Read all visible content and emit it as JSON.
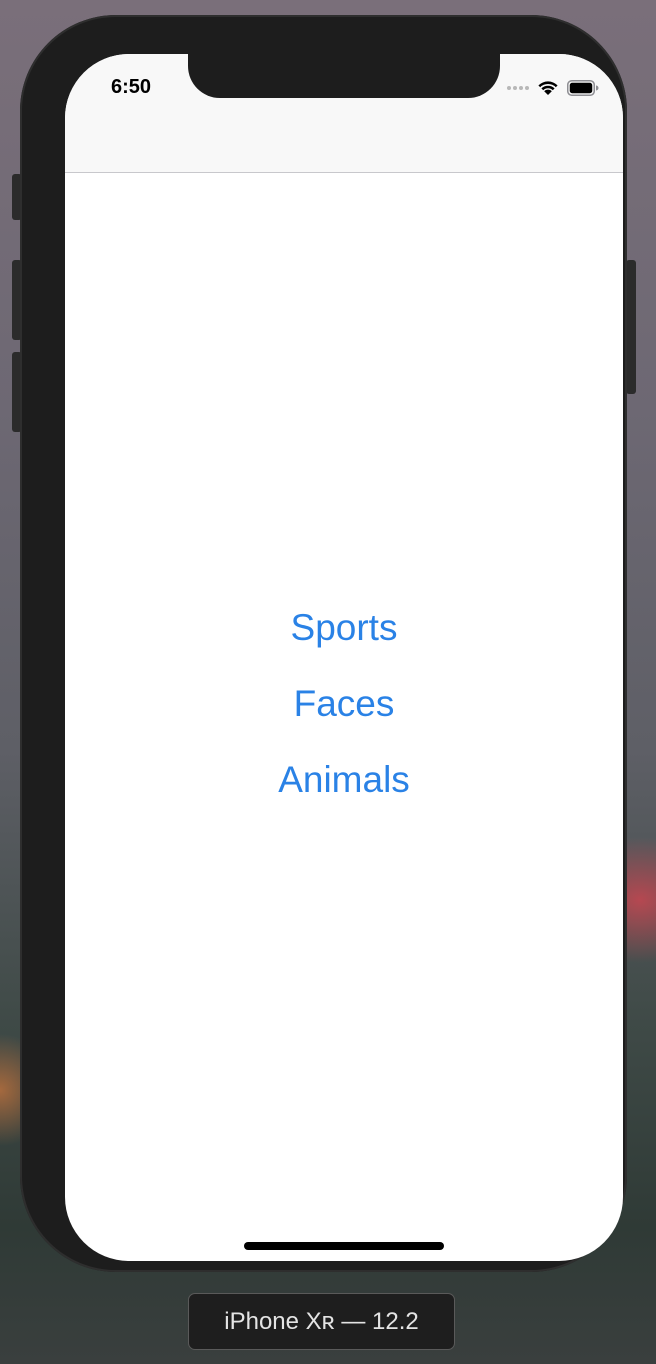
{
  "status_bar": {
    "time": "6:50",
    "icons": [
      "signal-dots-icon",
      "wifi-icon",
      "battery-icon"
    ]
  },
  "menu": {
    "items": [
      {
        "label": "Sports"
      },
      {
        "label": "Faces"
      },
      {
        "label": "Animals"
      }
    ]
  },
  "simulator": {
    "device_label": "iPhone Xʀ — 12.2"
  },
  "colors": {
    "accent": "#2a82e6",
    "nav_background": "#f8f8f8",
    "device_frame": "#1d1d1d"
  }
}
